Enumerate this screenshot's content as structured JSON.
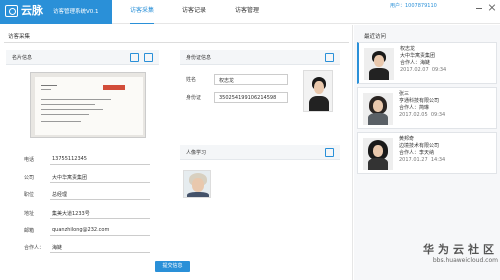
{
  "brand": {
    "name": "云脉",
    "system": "访客管理系统V0.1"
  },
  "nav": {
    "tabs": [
      "访客采集",
      "访客记录",
      "访客管理"
    ],
    "active": 0
  },
  "user": {
    "label": "用户：1007879110"
  },
  "main": {
    "title": "访客采集",
    "card_section": "名片信息",
    "id_section": "身份证信息",
    "portrait_section": "人像学习",
    "form": [
      {
        "label": "电话",
        "value": "13755112345"
      },
      {
        "label": "公司",
        "value": "大中华寓责集团"
      },
      {
        "label": "职位",
        "value": "总经理"
      },
      {
        "label": "地址",
        "value": "集美大道1233号"
      },
      {
        "label": "邮箱",
        "value": "quanzhilong@232.com"
      },
      {
        "label": "合作人：",
        "value": "海鲢"
      }
    ],
    "id_form": [
      {
        "label": "姓名",
        "value": "权志龙"
      },
      {
        "label": "身份证",
        "value": "350254199106214598"
      }
    ],
    "submit_label": "提交信息"
  },
  "sidebar": {
    "title": "最近访问",
    "visitors": [
      {
        "name": "权志龙",
        "company": "大中华寓责集团",
        "partner": "合作人：海鲢",
        "date": "2017.02.07",
        "time": "09:34"
      },
      {
        "name": "张三",
        "company": "亨通科技有限公司",
        "partner": "合作人：简琳",
        "date": "2017.02.05",
        "time": "09:34"
      },
      {
        "name": "黄邦奇",
        "company": "边境技术有限公司",
        "partner": "合作人：李天纳",
        "date": "2017.01.27",
        "time": "14:34"
      }
    ]
  },
  "watermark": {
    "cn": "华为云社区",
    "url": "bbs.huaweicloud.com"
  },
  "colors": {
    "accent": "#2a90d8",
    "brand_bg": "#2a90d8",
    "submit": "#2a90d8"
  }
}
